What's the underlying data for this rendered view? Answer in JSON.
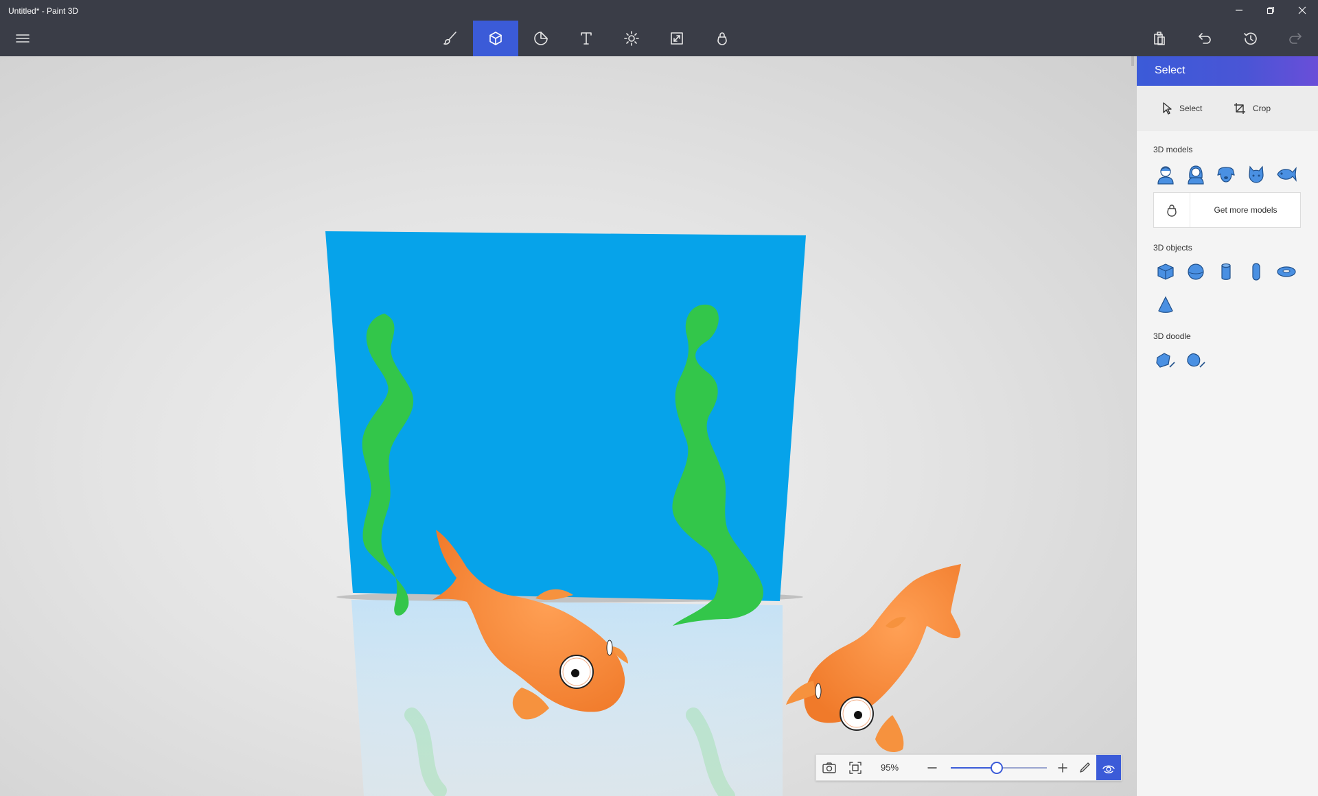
{
  "window": {
    "title": "Untitled* - Paint 3D",
    "controls": [
      "minimize-icon",
      "restore-icon",
      "close-icon"
    ]
  },
  "toolbar": {
    "menu_icon": "hamburger-menu-icon",
    "tools": [
      {
        "name": "brushes",
        "icon": "brush-icon",
        "active": false
      },
      {
        "name": "3d-shapes",
        "icon": "cube-icon",
        "active": true
      },
      {
        "name": "stickers",
        "icon": "sticker-icon",
        "active": false
      },
      {
        "name": "text",
        "icon": "text-icon",
        "active": false
      },
      {
        "name": "effects",
        "icon": "sun-icon",
        "active": false
      },
      {
        "name": "canvas",
        "icon": "canvas-resize-icon",
        "active": false
      },
      {
        "name": "3d-library",
        "icon": "library-icon",
        "active": false
      }
    ],
    "right_actions": [
      "paste-icon",
      "undo-icon",
      "history-icon",
      "redo-icon"
    ]
  },
  "panel": {
    "title": "Select",
    "select_label": "Select",
    "crop_label": "Crop",
    "models_label": "3D models",
    "models": [
      "man-icon",
      "woman-icon",
      "dog-icon",
      "cat-icon",
      "fish-icon"
    ],
    "get_more_label": "Get more models",
    "objects_label": "3D objects",
    "objects": [
      "cube-icon",
      "sphere-icon",
      "cylinder-icon",
      "capsule-icon",
      "torus-icon",
      "cone-icon"
    ],
    "doodle_label": "3D doodle",
    "doodles": [
      "sharp-edge-doodle-icon",
      "soft-edge-doodle-icon"
    ]
  },
  "zoom": {
    "value_label": "95%",
    "level": 0.48
  },
  "colors": {
    "accent": "#3b5bd8",
    "canvas_blue": "#06a3ea",
    "seaweed_green": "#33c64a",
    "fish_orange": "#f78a3a"
  }
}
